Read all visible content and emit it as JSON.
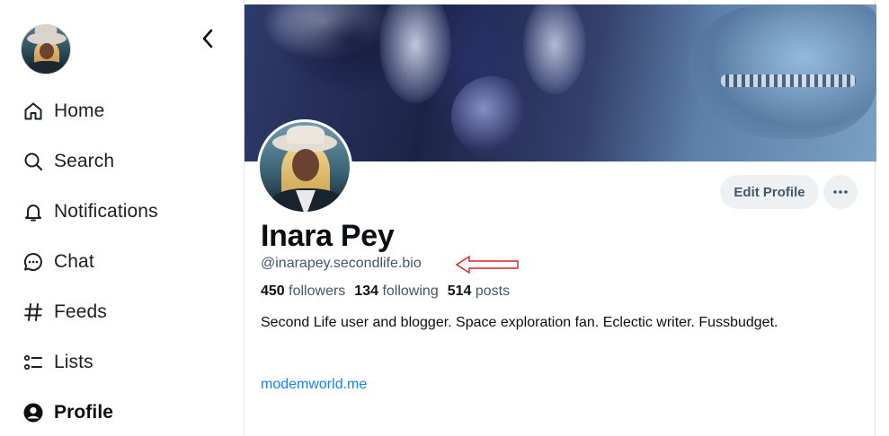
{
  "sidebar": {
    "items": [
      {
        "label": "Home",
        "icon": "home-icon"
      },
      {
        "label": "Search",
        "icon": "search-icon"
      },
      {
        "label": "Notifications",
        "icon": "bell-icon"
      },
      {
        "label": "Chat",
        "icon": "chat-icon"
      },
      {
        "label": "Feeds",
        "icon": "hash-icon"
      },
      {
        "label": "Lists",
        "icon": "lists-icon"
      },
      {
        "label": "Profile",
        "icon": "profile-icon",
        "active": true
      }
    ]
  },
  "profile": {
    "display_name": "Inara Pey",
    "handle": "@inarapey.secondlife.bio",
    "followers_count": "450",
    "followers_label": "followers",
    "following_count": "134",
    "following_label": "following",
    "posts_count": "514",
    "posts_label": "posts",
    "bio": "Second Life user and blogger. Space exploration fan. Eclectic writer. Fussbudget.",
    "link": "modemworld.me"
  },
  "actions": {
    "edit_profile": "Edit Profile"
  },
  "colors": {
    "link": "#1083fe",
    "muted_text": "#42576c",
    "button_bg": "#eef1f4",
    "annotation_arrow": "#d62020"
  }
}
